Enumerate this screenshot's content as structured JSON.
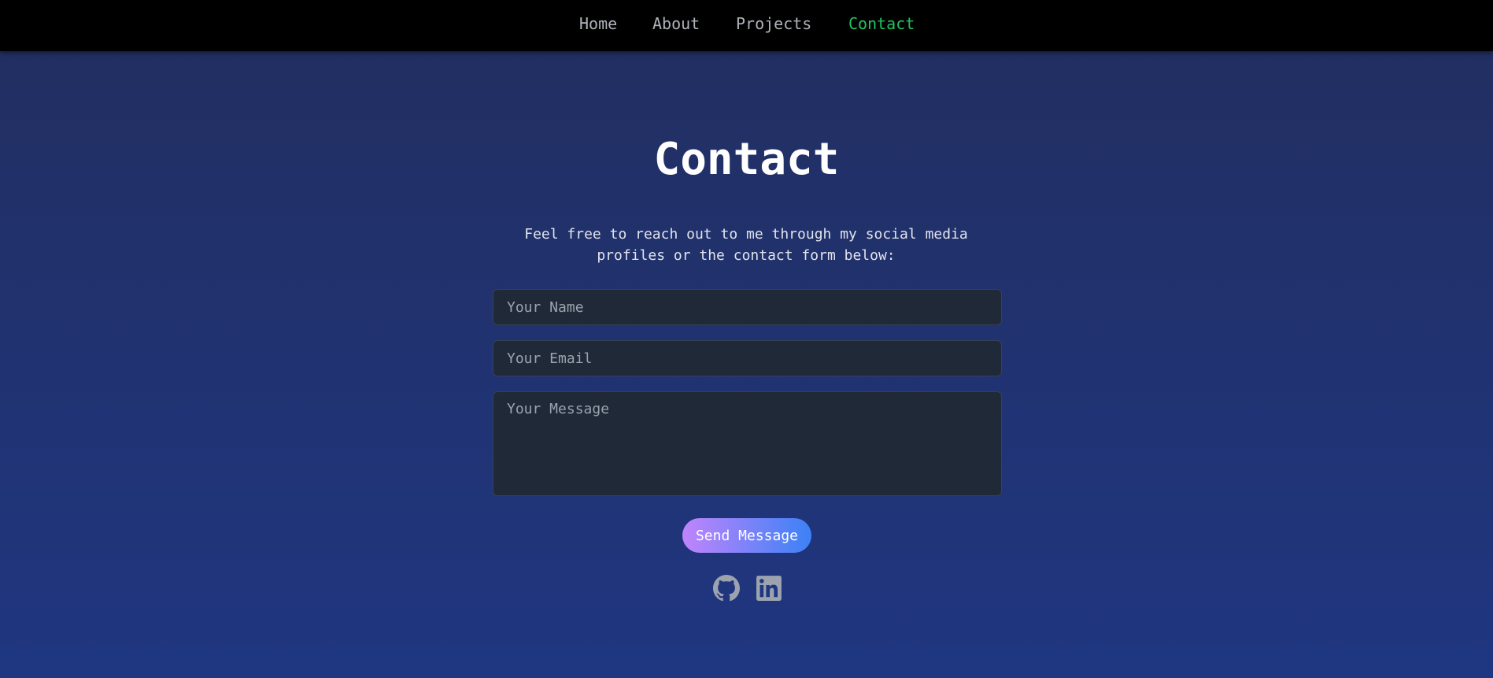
{
  "nav": {
    "items": [
      {
        "label": "Home"
      },
      {
        "label": "About"
      },
      {
        "label": "Projects"
      },
      {
        "label": "Contact"
      }
    ],
    "active": "Contact"
  },
  "contact": {
    "title": "Contact",
    "intro": "Feel free to reach out to me through my social media profiles or the contact form below:",
    "form": {
      "name_placeholder": "Your Name",
      "email_placeholder": "Your Email",
      "message_placeholder": "Your Message",
      "submit_label": "Send Message"
    },
    "socials": [
      {
        "icon": "github-icon"
      },
      {
        "icon": "linkedin-icon"
      }
    ]
  },
  "colors": {
    "nav_background": "#000000",
    "nav_link": "#b0b3bb",
    "nav_active": "#22c55e",
    "page_gradient_top": "#222e5f",
    "page_gradient_bottom": "#1f3681",
    "field_background": "#1f2937",
    "button_gradient_start": "#c084fc",
    "button_gradient_end": "#3b82f6",
    "social_icon": "#9ca3af"
  }
}
